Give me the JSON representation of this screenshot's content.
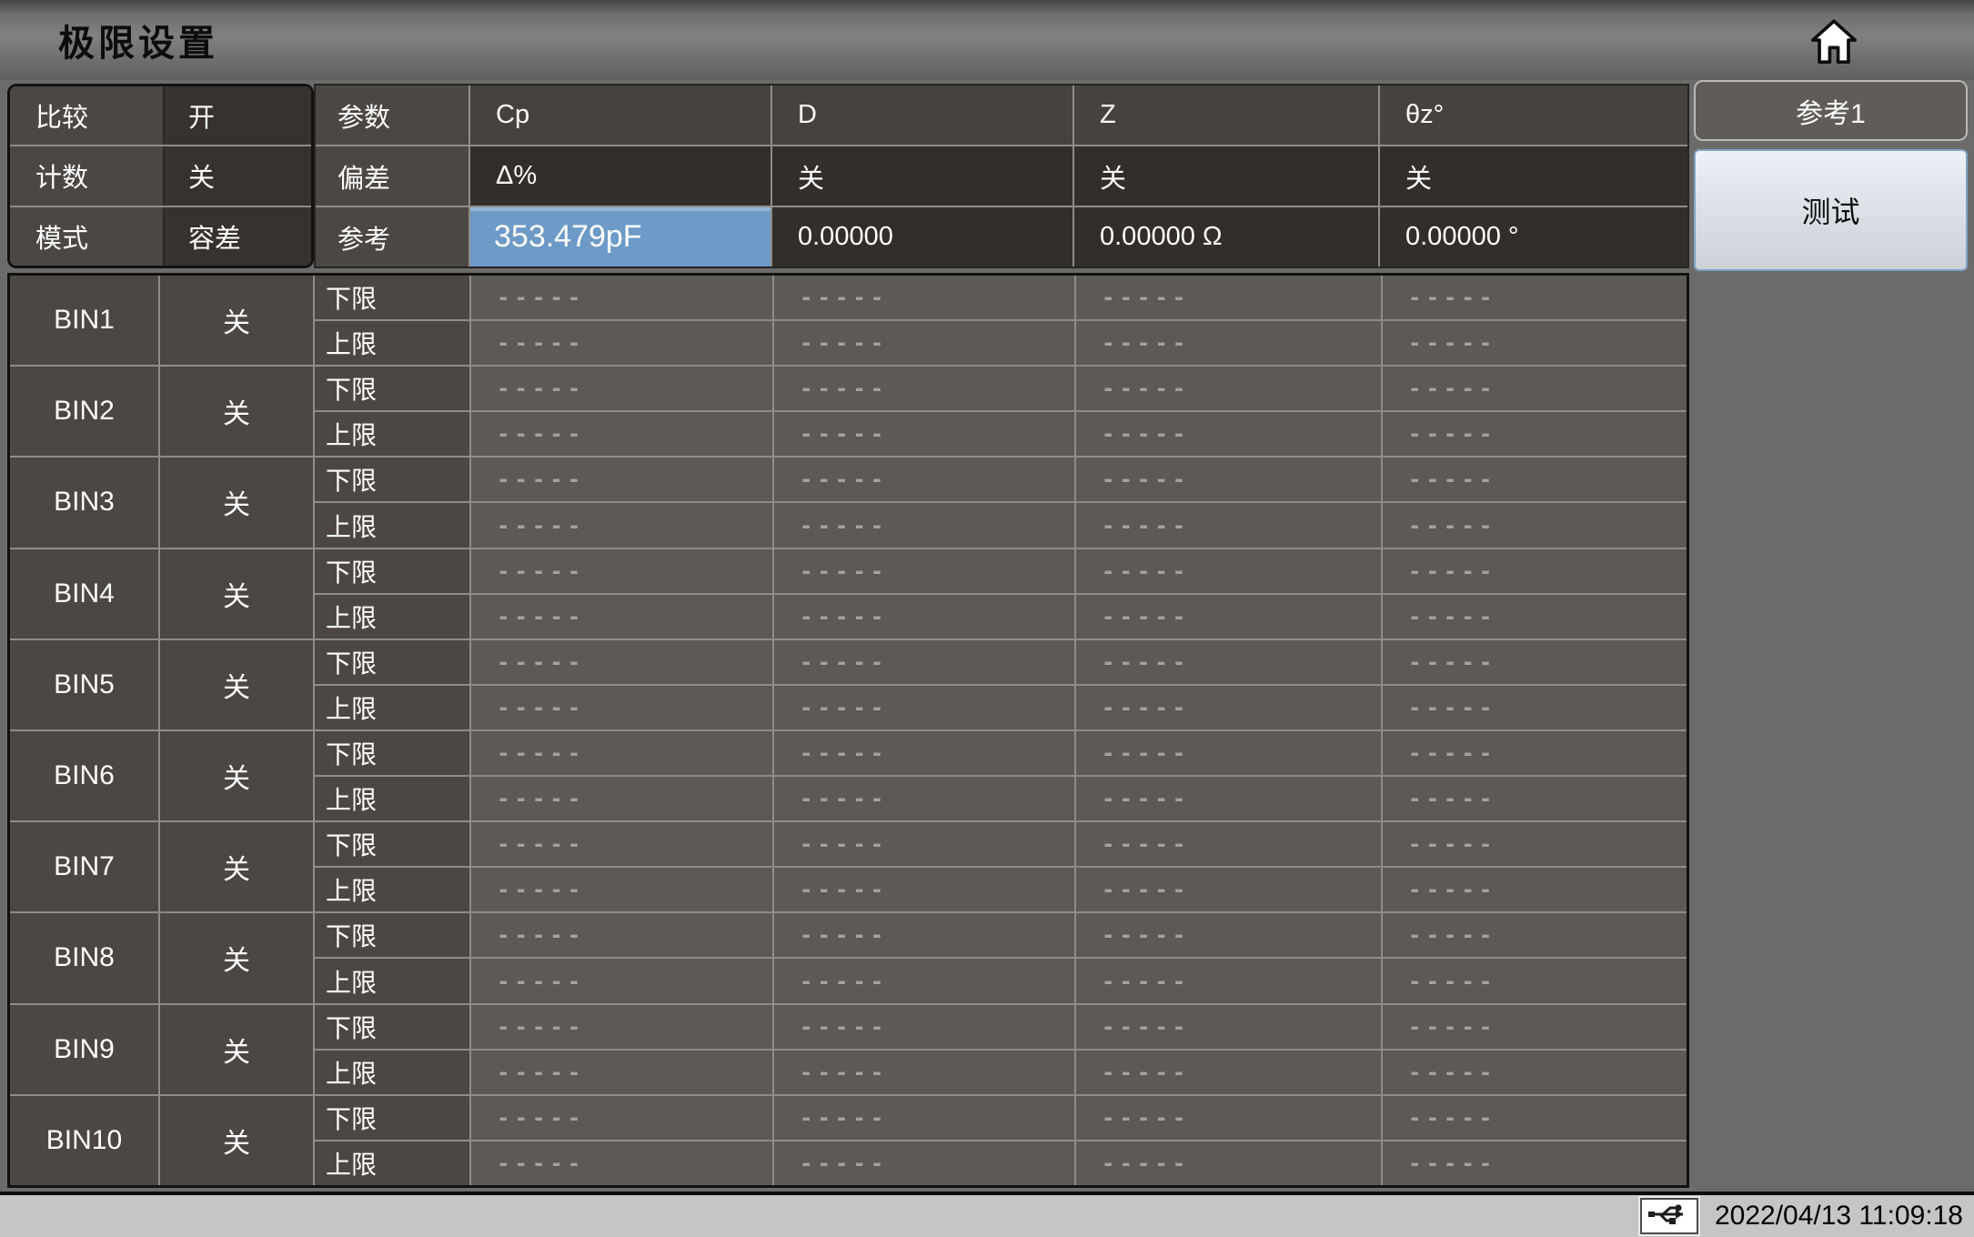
{
  "title": "极限设置",
  "icons": {
    "home": "home-icon",
    "usb": "usb-icon"
  },
  "colors": {
    "highlight_blue": "#6d9ac6",
    "panel_dark": "#332e2a",
    "cell_label": "#4c4743",
    "statusbar_bg": "#c5c5c5"
  },
  "compare_block": {
    "rows": [
      {
        "label": "比较",
        "value": "开"
      },
      {
        "label": "计数",
        "value": "关"
      },
      {
        "label": "模式",
        "value": "容差"
      }
    ]
  },
  "params_table": {
    "rows": [
      {
        "label": "参数",
        "values": [
          "Cp",
          "D",
          "Z",
          "θz°"
        ]
      },
      {
        "label": "偏差",
        "values": [
          "Δ%",
          "关",
          "关",
          "关"
        ]
      },
      {
        "label": "参考",
        "values": [
          "353.479pF",
          "0.00000",
          "0.00000 Ω",
          "0.00000 °"
        ],
        "highlight_index": 0
      }
    ]
  },
  "sidebar": {
    "reference_tab": "参考1",
    "test_button": "测试"
  },
  "bin_table": {
    "limit_labels": [
      "下限",
      "上限"
    ],
    "placeholder": "-----",
    "value_columns": 4,
    "bins": [
      {
        "name": "BIN1",
        "state": "关"
      },
      {
        "name": "BIN2",
        "state": "关"
      },
      {
        "name": "BIN3",
        "state": "关"
      },
      {
        "name": "BIN4",
        "state": "关"
      },
      {
        "name": "BIN5",
        "state": "关"
      },
      {
        "name": "BIN6",
        "state": "关"
      },
      {
        "name": "BIN7",
        "state": "关"
      },
      {
        "name": "BIN8",
        "state": "关"
      },
      {
        "name": "BIN9",
        "state": "关"
      },
      {
        "name": "BIN10",
        "state": "关"
      }
    ]
  },
  "status_bar": {
    "datetime": "2022/04/13 11:09:18"
  }
}
